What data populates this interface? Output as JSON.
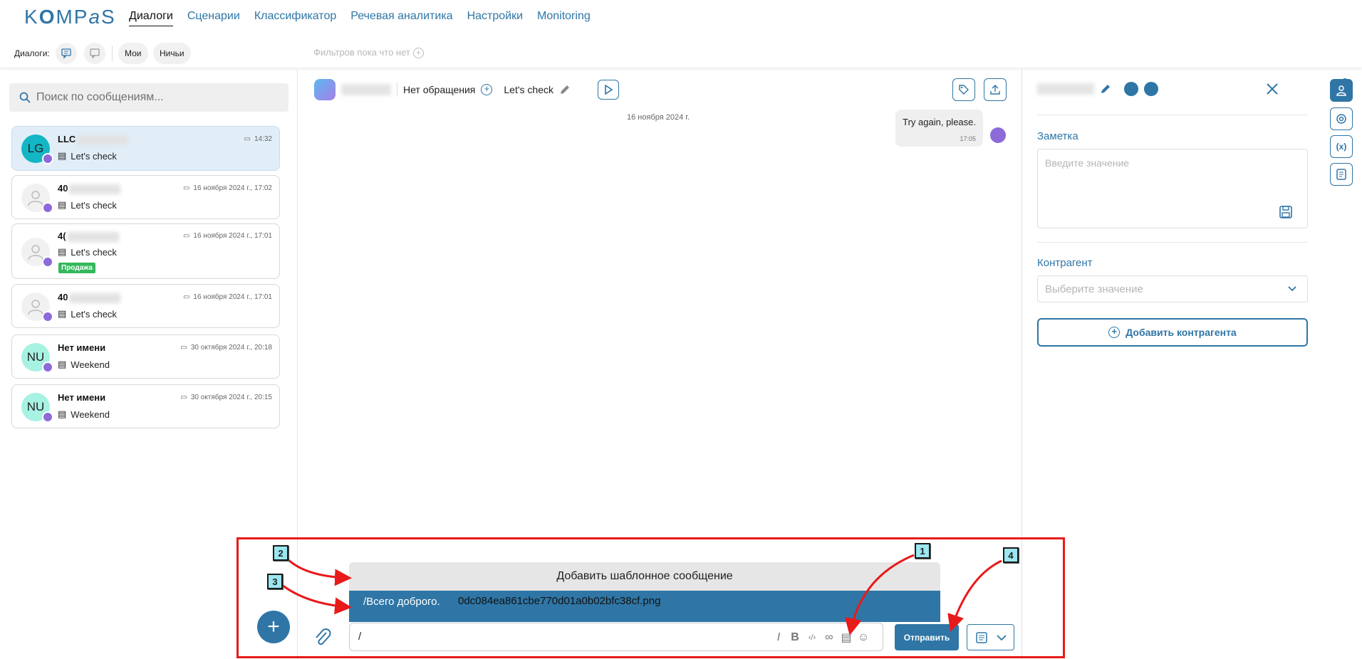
{
  "app": {
    "logo": "KOMPaS",
    "accent": "#2f76a6"
  },
  "nav": {
    "items": [
      "Диалоги",
      "Сценарии",
      "Классификатор",
      "Речевая аналитика",
      "Настройки",
      "Monitoring"
    ],
    "active": "Диалоги"
  },
  "filters": {
    "label": "Диалоги:",
    "mine": "Мои",
    "nobody": "Ничьи",
    "empty_text": "Фильтров пока что нет"
  },
  "search": {
    "placeholder": "Поиск по сообщениям..."
  },
  "chats": [
    {
      "avatar": "LG",
      "name": "LLC",
      "time": "14:32",
      "message": "Let's check",
      "tag": ""
    },
    {
      "avatar": "",
      "name": "40",
      "time": "16 ноября 2024 г., 17:02",
      "message": "Let's check",
      "tag": ""
    },
    {
      "avatar": "",
      "name": "4(",
      "time": "16 ноября 2024 г., 17:01",
      "message": "Let's check",
      "tag": "Продажа"
    },
    {
      "avatar": "",
      "name": "40",
      "time": "16 ноября 2024 г., 17:01",
      "message": "Let's check",
      "tag": ""
    },
    {
      "avatar": "NU",
      "name": "Нет имени",
      "time": "30 октября 2024 г., 20:18",
      "message": "Weekend",
      "tag": ""
    },
    {
      "avatar": "NU",
      "name": "Нет имени",
      "time": "30 октября 2024 г., 20:15",
      "message": "Weekend",
      "tag": ""
    }
  ],
  "conversation": {
    "appeal": "Нет обращения",
    "topic": "Let's check",
    "date": "16 ноября 2024 г.",
    "messages": [
      {
        "text": "Try again, please.",
        "time": "17:05"
      }
    ]
  },
  "templates": {
    "title": "Добавить шаблонное сообщение",
    "items": [
      {
        "command": "/Всего доброго.",
        "file": "0dc084ea861cbe770d01a0b02bfc38cf.png"
      }
    ]
  },
  "composer": {
    "value": "/",
    "send_label": "Отправить"
  },
  "annotations": [
    "1",
    "2",
    "3",
    "4"
  ],
  "contact": {
    "note_label": "Заметка",
    "note_placeholder": "Введите значение",
    "counterparty_label": "Контрагент",
    "counterparty_placeholder": "Выберите значение",
    "add_counterparty": "Добавить контрагента"
  }
}
